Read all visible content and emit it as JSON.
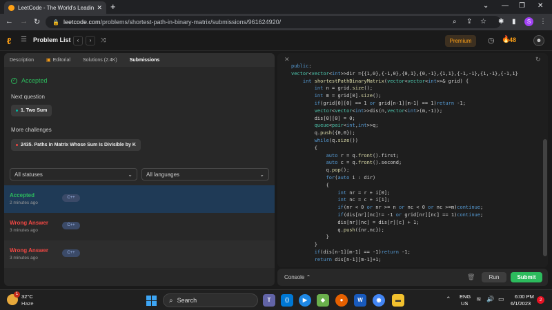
{
  "browser": {
    "tab_title": "LeetCode - The World's Leading",
    "tab_close": "✕",
    "new_tab": "+",
    "url_host": "leetcode.com",
    "url_path": "/problems/shortest-path-in-binary-matrix/submissions/961624920/",
    "profile_initial": "S",
    "minimize": "—",
    "maximize": "❐",
    "close": "✕"
  },
  "lc_header": {
    "problem_list": "Problem List",
    "premium": "Premium",
    "streak": "48"
  },
  "left_tabs": [
    {
      "label": "Description"
    },
    {
      "label": "Editorial"
    },
    {
      "label": "Solutions (2.4K)"
    },
    {
      "label": "Submissions"
    }
  ],
  "result": {
    "status": "Accepted",
    "next_question_label": "Next question",
    "next_question": "1. Two Sum",
    "more_challenges_label": "More challenges",
    "more_challenge": "2435. Paths in Matrix Whose Sum Is Divisible by K"
  },
  "filters": {
    "status": "All statuses",
    "language": "All languages"
  },
  "submissions": [
    {
      "status": "Accepted",
      "time": "2 minutes ago",
      "lang": "C++",
      "color": "#2cbb5d"
    },
    {
      "status": "Wrong Answer",
      "time": "3 minutes ago",
      "lang": "C++",
      "color": "#ef4743"
    },
    {
      "status": "Wrong Answer",
      "time": "3 minutes ago",
      "lang": "C++",
      "color": "#ef4743"
    }
  ],
  "editor": {
    "lines": [
      "public:",
      "vector<vector<int>>dir ={{1,0},{-1,0},{0,1},{0,-1},{1,1},{-1,-1},{1,-1},{-1,1}",
      "    int shortestPathBinaryMatrix(vector<vector<int>>& grid) {",
      "        int n = grid.size();",
      "        int m = grid[0].size();",
      "        if(grid[0][0] == 1 or grid[n-1][m-1] == 1)return -1;",
      "        vector<vector<int>>dis(n,vector<int>(m,-1));",
      "        dis[0][0] = 0;",
      "        queue<pair<int,int>>q;",
      "        q.push({0,0});",
      "        while(q.size())",
      "        {",
      "            auto r = q.front().first;",
      "            auto c = q.front().second;",
      "            q.pop();",
      "            for(auto i : dir)",
      "            {",
      "                int nr = r + i[0];",
      "                int nc = c + i[1];",
      "                if(nr < 0 or nr >= n or nc < 0 or nc >=m)continue;",
      "                if(dis[nr][nc]!= -1 or grid[nr][nc] == 1)continue;",
      "                dis[nr][nc] = dis[r][c] + 1;",
      "                q.push({nr,nc});",
      "            }",
      "        }",
      "        if(dis[n-1][m-1] == -1)return -1;",
      "        return dis[n-1][m-1]+1;"
    ]
  },
  "console": {
    "label": "Console",
    "run": "Run",
    "submit": "Submit"
  },
  "taskbar": {
    "temperature": "32°C",
    "weather": "Haze",
    "weather_badge": "1",
    "search": "Search",
    "lang1": "ENG",
    "lang2": "US",
    "time": "6:00 PM",
    "date": "6/1/2023",
    "notifications": "2"
  }
}
